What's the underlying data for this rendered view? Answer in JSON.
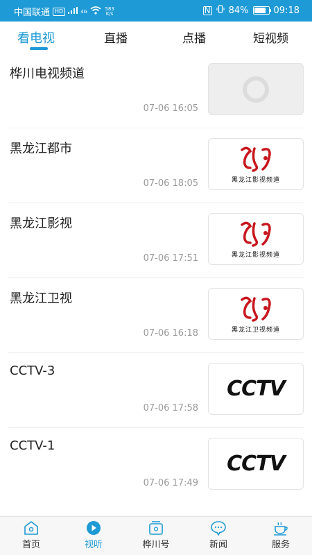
{
  "status_bar": {
    "carrier": "中国联通",
    "hd_badge": "HD",
    "network": "4G",
    "speed_value": "583",
    "speed_unit": "K/s",
    "nfc": "N",
    "battery": "84%",
    "battery_level": 0.84,
    "time": "09:18"
  },
  "tabs": [
    {
      "label": "看电视",
      "active": true
    },
    {
      "label": "直播",
      "active": false
    },
    {
      "label": "点播",
      "active": false
    },
    {
      "label": "短视频",
      "active": false
    }
  ],
  "channels": [
    {
      "name": "桦川电视频道",
      "time": "07-06 16:05",
      "thumb": "placeholder-ring"
    },
    {
      "name": "黑龙江都市",
      "time": "07-06 18:05",
      "thumb": "hlj-logo",
      "logo_text": "黑龙江影视频道"
    },
    {
      "name": "黑龙江影视",
      "time": "07-06 17:51",
      "thumb": "hlj-logo",
      "logo_text": "黑龙江影视频道"
    },
    {
      "name": "黑龙江卫视",
      "time": "07-06 16:18",
      "thumb": "hlj-logo",
      "logo_text": "黑龙江卫视频道"
    },
    {
      "name": "CCTV-3",
      "time": "07-06 17:58",
      "thumb": "cctv-logo",
      "logo_text": "CCTV"
    },
    {
      "name": "CCTV-1",
      "time": "07-06 17:49",
      "thumb": "cctv-logo",
      "logo_text": "CCTV"
    }
  ],
  "bottom_nav": [
    {
      "label": "首页",
      "icon": "home-icon",
      "active": false
    },
    {
      "label": "视听",
      "icon": "play-icon",
      "active": true
    },
    {
      "label": "桦川号",
      "icon": "tv-box-icon",
      "active": false
    },
    {
      "label": "新闻",
      "icon": "chat-bubble-icon",
      "active": false
    },
    {
      "label": "服务",
      "icon": "cup-icon",
      "active": false
    }
  ],
  "colors": {
    "accent": "#1e9ad6",
    "logo_red": "#c8161d"
  }
}
